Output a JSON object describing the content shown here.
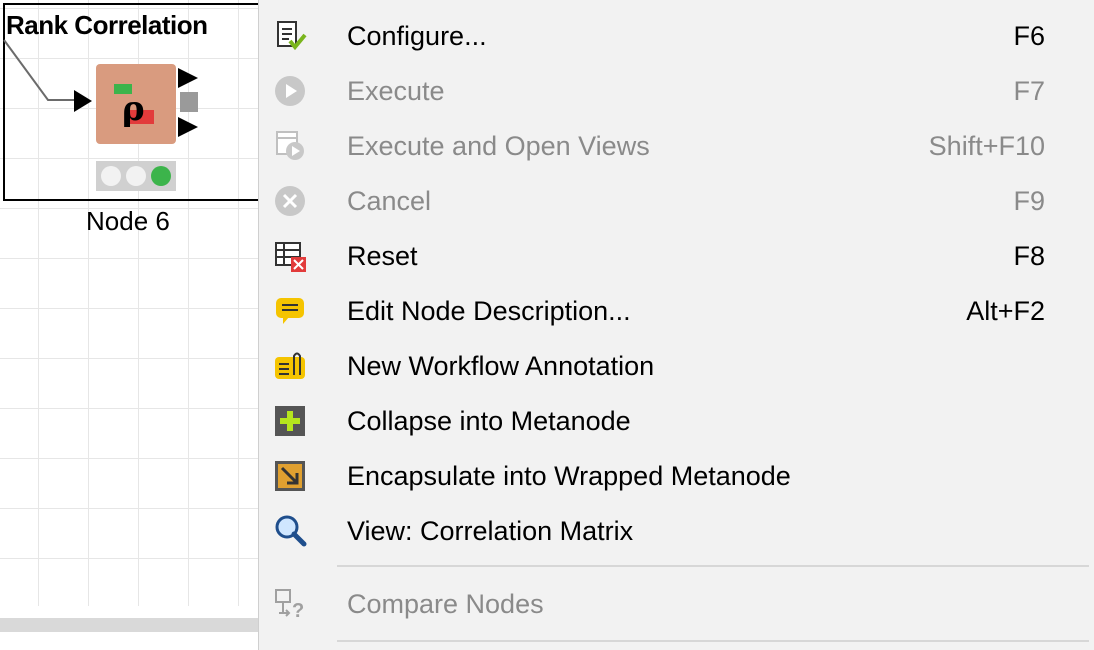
{
  "canvas": {
    "node_title": "Rank Correlation",
    "node_label": "Node 6",
    "node_icon_glyph": "ρ"
  },
  "menu": {
    "items": [
      {
        "label": "Configure...",
        "shortcut": "F6",
        "icon": "configure-icon",
        "enabled": true
      },
      {
        "label": "Execute",
        "shortcut": "F7",
        "icon": "execute-icon",
        "enabled": false
      },
      {
        "label": "Execute and Open Views",
        "shortcut": "Shift+F10",
        "icon": "execute-open-views-icon",
        "enabled": false
      },
      {
        "label": "Cancel",
        "shortcut": "F9",
        "icon": "cancel-icon",
        "enabled": false
      },
      {
        "label": "Reset",
        "shortcut": "F8",
        "icon": "reset-icon",
        "enabled": true
      },
      {
        "label": "Edit Node Description...",
        "shortcut": "Alt+F2",
        "icon": "edit-description-icon",
        "enabled": true
      },
      {
        "label": "New Workflow Annotation",
        "shortcut": "",
        "icon": "annotation-icon",
        "enabled": true
      },
      {
        "label": "Collapse into Metanode",
        "shortcut": "",
        "icon": "collapse-metanode-icon",
        "enabled": true
      },
      {
        "label": "Encapsulate into Wrapped Metanode",
        "shortcut": "",
        "icon": "wrapped-metanode-icon",
        "enabled": true
      },
      {
        "label": "View: Correlation Matrix",
        "shortcut": "",
        "icon": "magnifier-icon",
        "enabled": true
      },
      {
        "label": "Compare Nodes",
        "shortcut": "",
        "icon": "compare-nodes-icon",
        "enabled": false
      }
    ]
  },
  "colors": {
    "menu_bg": "#f2f2f2",
    "disabled_text": "#8a8a8a",
    "node_body": "#d99b7f",
    "status_green": "#3cb44b",
    "accent_yellow": "#f5c400"
  }
}
